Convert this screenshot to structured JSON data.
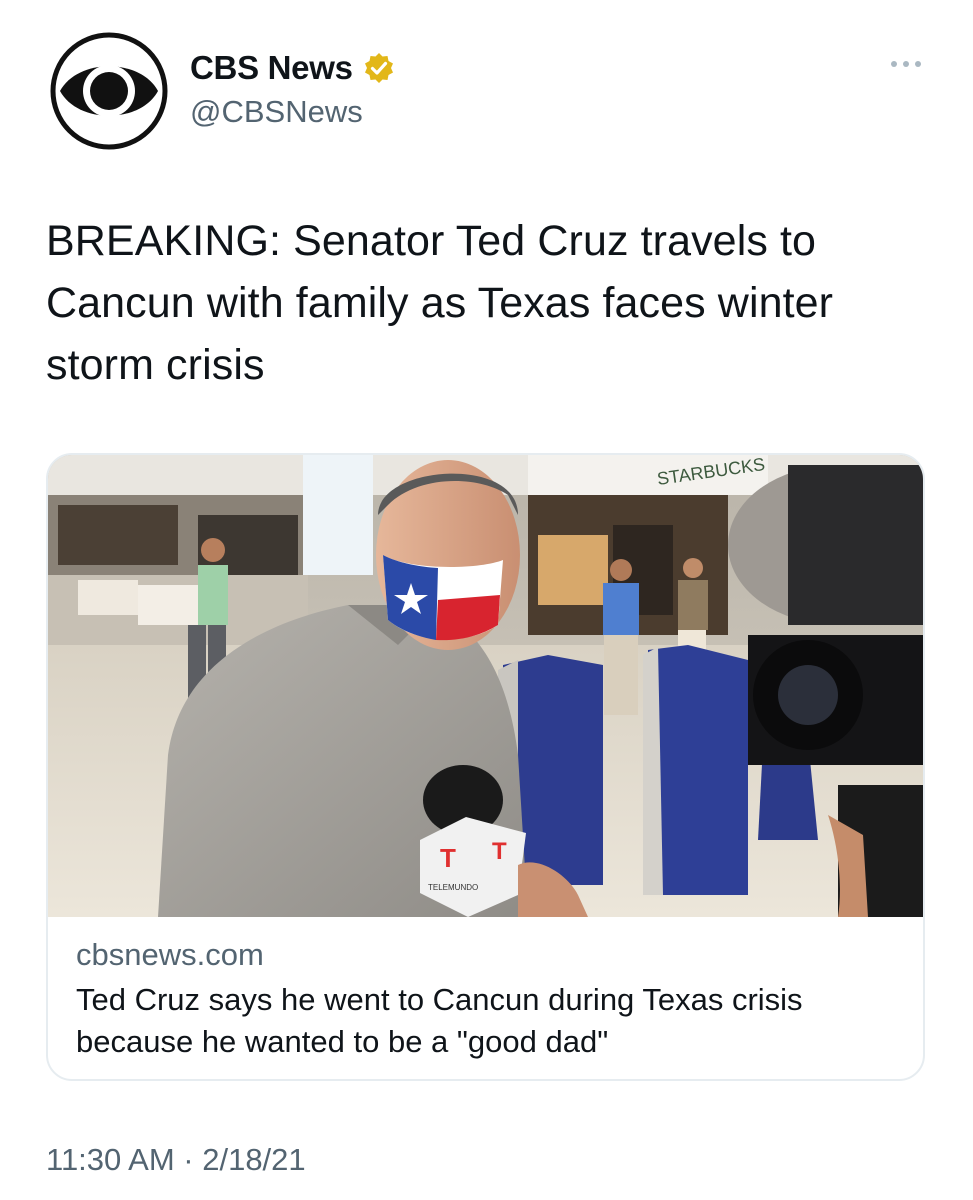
{
  "author": {
    "name": "CBS News",
    "handle": "@CBSNews",
    "verified": true,
    "avatar_icon": "cbs-eye-logo"
  },
  "more_icon": "ellipsis-icon",
  "tweet": {
    "text": "BREAKING: Senator Ted Cruz travels to Cancun with family as Texas faces winter storm crisis"
  },
  "link_card": {
    "image_description": "Man in Texas-flag face mask speaking into a Telemundo microphone in an airport terminal",
    "microphone_label": "TELEMUNDO",
    "domain": "cbsnews.com",
    "headline": "Ted Cruz says he went to Cancun during Texas crisis because he wanted to be a \"good dad\""
  },
  "timestamp": "11:30 AM · 2/18/21",
  "colors": {
    "text": "#0f1419",
    "secondary": "#536471",
    "border": "#e6ecf0",
    "verified_badge": "#e2b719"
  }
}
